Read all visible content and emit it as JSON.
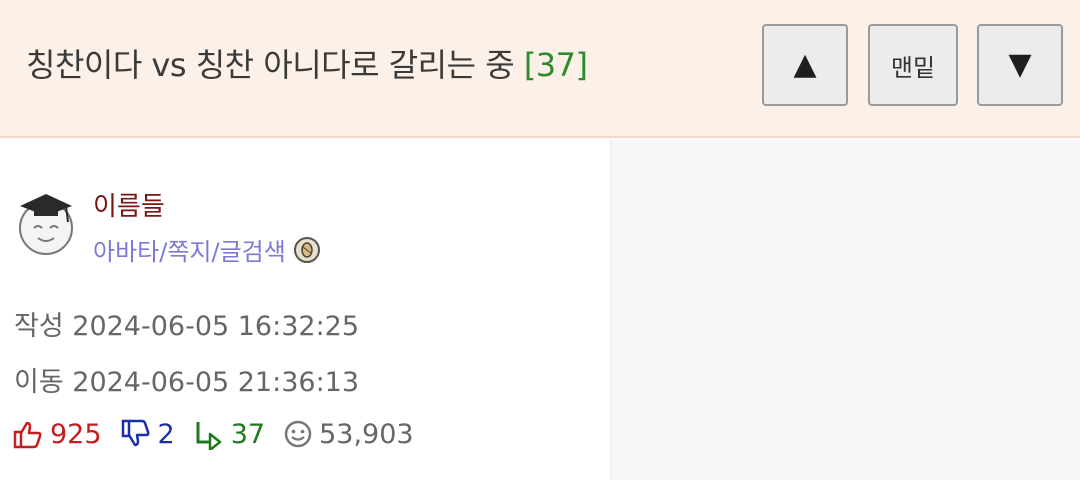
{
  "header": {
    "title": "칭찬이다 vs 칭찬 아니다로 갈리는 중",
    "comment_count": "[37]",
    "buttons": {
      "up_symbol": "▲",
      "bottom_label": "맨밑",
      "down_symbol": "▼"
    }
  },
  "author": {
    "name": "이름들",
    "links": "아바타/쪽지/글검색",
    "avatar_icon": "graduate-face-icon",
    "badge_icon": "peanut-badge-icon"
  },
  "meta": {
    "created": "작성 2024-06-05 16:32:25",
    "moved": "이동 2024-06-05 21:36:13"
  },
  "stats": {
    "upvotes": "925",
    "downvotes": "2",
    "replies": "37",
    "views": "53,903"
  },
  "colors": {
    "header_bg": "#fcf1e8",
    "username": "#7a1515",
    "links": "#7b7bd6",
    "upvote": "#c41d1d",
    "downvote": "#1c2fa8",
    "reply": "#1d7a1d",
    "count": "#2e8b2e"
  }
}
